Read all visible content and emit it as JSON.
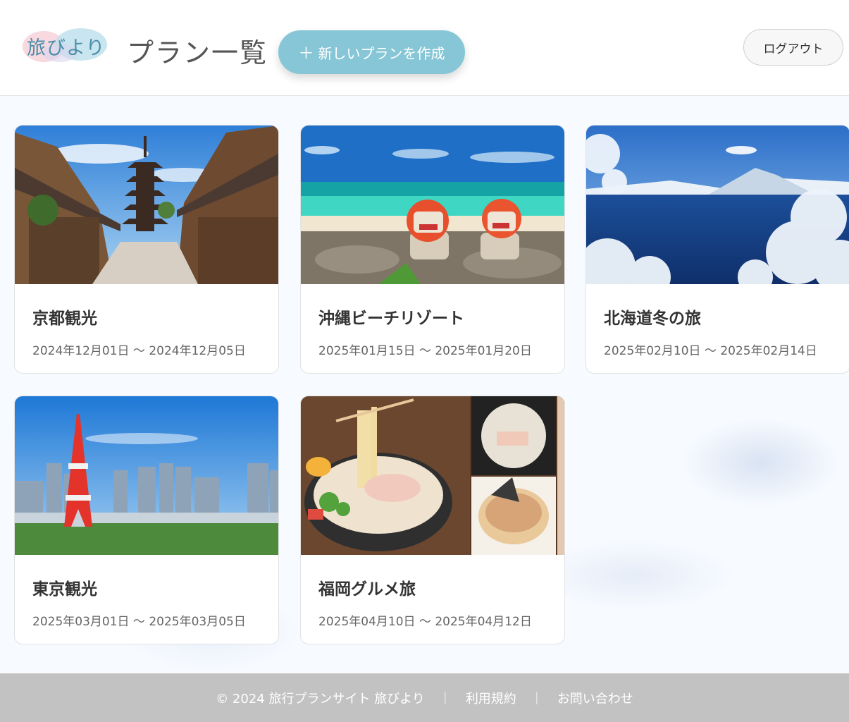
{
  "header": {
    "logo_text": "旅びより",
    "page_title": "プラン一覧",
    "new_plan_plus": "＋",
    "new_plan_label": "新しいプランを作成",
    "logout_label": "ログアウト"
  },
  "plans": [
    {
      "title": "京都観光",
      "dates": "2024年12月01日 〜 2024年12月05日",
      "image": "kyoto-pagoda-street-photo"
    },
    {
      "title": "沖縄ビーチリゾート",
      "dates": "2025年01月15日 〜 2025年01月20日",
      "image": "okinawa-shisa-beach-photo"
    },
    {
      "title": "北海道冬の旅",
      "dates": "2025年02月10日 〜 2025年02月14日",
      "image": "hokkaido-winter-lake-photo"
    },
    {
      "title": "東京観光",
      "dates": "2025年03月01日 〜 2025年03月05日",
      "image": "tokyo-tower-skyline-photo"
    },
    {
      "title": "福岡グルメ旅",
      "dates": "2025年04月10日 〜 2025年04月12日",
      "image": "fukuoka-ramen-collage-photo"
    }
  ],
  "footer": {
    "copyright": "© 2024 旅行プランサイト 旅びより",
    "separator": "｜",
    "terms": "利用規約",
    "contact": "お問い合わせ"
  },
  "colors": {
    "accent": "#86c6d6",
    "footer_bg": "#c2c2c2",
    "logo_text": "#4a8ea8"
  }
}
